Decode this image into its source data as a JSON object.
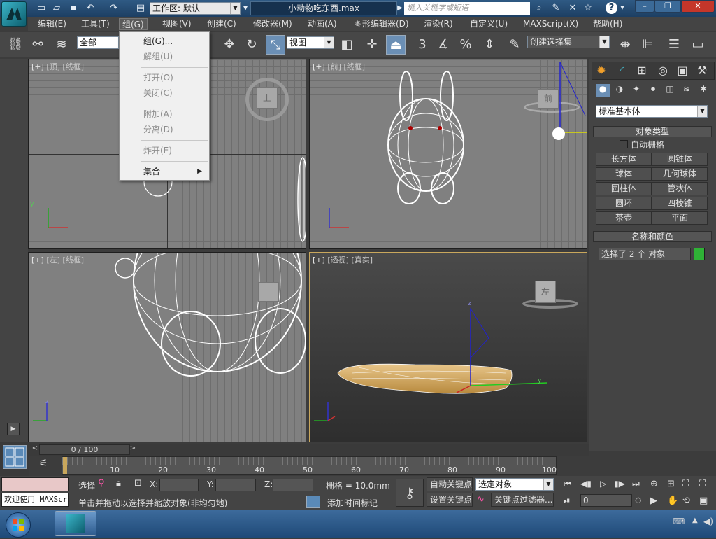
{
  "title": {
    "workspace_label": "工作区: 默认",
    "file_name": "小动物吃东西.max",
    "search_placeholder": "键入关键字或短语"
  },
  "menubar": {
    "items": [
      "编辑(E)",
      "工具(T)",
      "组(G)",
      "视图(V)",
      "创建(C)",
      "修改器(M)",
      "动画(A)",
      "图形编辑器(D)",
      "渲染(R)",
      "自定义(U)",
      "MAXScript(X)",
      "帮助(H)"
    ]
  },
  "group_menu": {
    "items": [
      {
        "label": "组(G)...",
        "enabled": true
      },
      {
        "label": "解组(U)",
        "enabled": false
      },
      {
        "label": "打开(O)",
        "enabled": false
      },
      {
        "label": "关闭(C)",
        "enabled": false
      },
      {
        "label": "附加(A)",
        "enabled": false
      },
      {
        "label": "分离(D)",
        "enabled": false
      },
      {
        "label": "炸开(E)",
        "enabled": false
      },
      {
        "label": "集合",
        "enabled": true,
        "submenu": true
      }
    ]
  },
  "toolbar": {
    "selection_filter": "全部",
    "ref_coord": "视图",
    "named_selection": "创建选择集",
    "snap_3": "3",
    "snap_pct": "%"
  },
  "viewports": {
    "top": {
      "plus": "[+]",
      "name": "[顶]",
      "mode": "[线框]",
      "cube": "上"
    },
    "front": {
      "plus": "[+]",
      "name": "[前]",
      "mode": "[线框]",
      "cube": "前"
    },
    "left": {
      "plus": "[+]",
      "name": "[左]",
      "mode": "[线框]",
      "cube": ""
    },
    "persp": {
      "plus": "[+]",
      "name": "[透视]",
      "mode": "[真实]",
      "cube": "左"
    },
    "axis_x": "x",
    "axis_y": "y",
    "axis_z": "z"
  },
  "command_panel": {
    "category": "标准基本体",
    "object_type_title": "对象类型",
    "auto_grid": "自动栅格",
    "buttons": [
      "长方体",
      "圆锥体",
      "球体",
      "几何球体",
      "圆柱体",
      "管状体",
      "圆环",
      "四棱锥",
      "茶壶",
      "平面"
    ],
    "name_color_title": "名称和颜色",
    "name_value": "选择了 2 个 对象",
    "color": "#2fb236"
  },
  "timeline": {
    "frame": "0 / 100",
    "ticks": [
      "10",
      "20",
      "30",
      "40",
      "50",
      "60",
      "70",
      "80",
      "90",
      "100"
    ],
    "current": 0,
    "max": 100
  },
  "status": {
    "maxscript": "欢迎使用 MAXScr",
    "select_label": "选择",
    "prompt": "单击并拖动以选择并缩放对象(非均匀地)",
    "x_label": "X:",
    "y_label": "Y:",
    "z_label": "Z:",
    "grid": "栅格 = 10.0mm",
    "add_time_tag": "添加时间标记",
    "auto_key": "自动关键点",
    "set_key": "设置关键点",
    "key_mode": "选定对象",
    "key_filter": "关键点过滤器...",
    "frame_field": "0"
  }
}
